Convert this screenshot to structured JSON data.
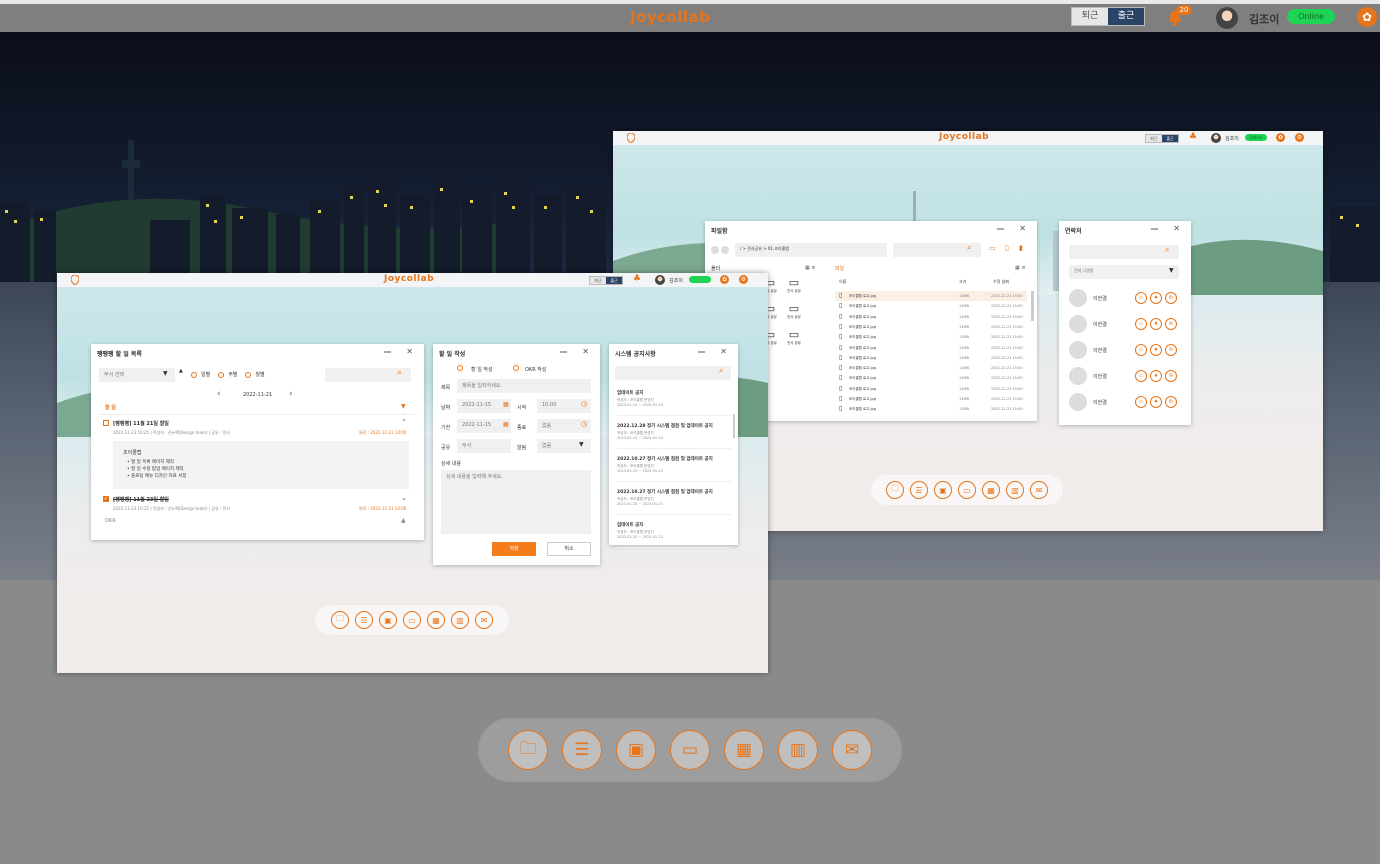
{
  "header": {
    "logo": "Joycollab",
    "clock_out": "퇴근",
    "clock_in": "출근",
    "notification_count": "20",
    "user_name": "김조이",
    "status": "Online"
  },
  "desktop2": {
    "logo": "Joycollab",
    "clock_out": "퇴근",
    "clock_in": "출근",
    "user_name": "김조이",
    "status": "Online",
    "files_window": {
      "title": "파일함",
      "path": "/ > 전사공유 > 01.조이콜랩",
      "folder_header": "폴더",
      "file_header": "파일",
      "columns": [
        "이름",
        "크기",
        "수정 날짜"
      ],
      "folder_label": "전사 공유",
      "files": [
        {
          "name": "조이콜랩 로고.jpg",
          "size": "11MB",
          "date": "2022-12-21 15:00"
        },
        {
          "name": "조이콜랩 로고.jpg",
          "size": "11MB",
          "date": "2022-12-21 15:00"
        },
        {
          "name": "조이콜랩 로고.jpg",
          "size": "11MB",
          "date": "2022-12-21 15:00"
        },
        {
          "name": "조이콜랩 로고.jpg",
          "size": "11MB",
          "date": "2022-12-21 15:00"
        },
        {
          "name": "조이콜랩 로고.jpg",
          "size": "11MB",
          "date": "2022-12-21 15:00"
        },
        {
          "name": "조이콜랩 로고.jpg",
          "size": "11MB",
          "date": "2022-12-21 15:00"
        },
        {
          "name": "조이콜랩 로고.jpg",
          "size": "11MB",
          "date": "2022-12-21 15:00"
        },
        {
          "name": "조이콜랩 로고.jpg",
          "size": "11MB",
          "date": "2022-12-21 15:00"
        },
        {
          "name": "조이콜랩 로고.jpg",
          "size": "11MB",
          "date": "2022-12-21 15:00"
        },
        {
          "name": "조이콜랩 로고.jpg",
          "size": "11MB",
          "date": "2022-12-21 15:00"
        },
        {
          "name": "조이콜랩 로고.jpg",
          "size": "11MB",
          "date": "2022-12-21 15:00"
        },
        {
          "name": "조이콜랩 로고.jpg",
          "size": "11MB",
          "date": "2022-12-21 15:00"
        }
      ]
    },
    "contacts_window": {
      "title": "연락처",
      "select": "전체 나열함",
      "contacts": [
        "이한결",
        "이한결",
        "이한결",
        "이한결",
        "이한결"
      ]
    }
  },
  "desktop1": {
    "logo": "Joycollab",
    "clock_out": "퇴근",
    "clock_in": "출근",
    "user_name": "김조이",
    "todo_window": {
      "title": "팽팽팽 할 일 목록",
      "dept_select": "부서 선택",
      "radio": [
        "일별",
        "주별",
        "월별"
      ],
      "date": "2022-11-21",
      "section_todo": "할 일",
      "item1_title": "[팽팽팽] 11월 21일 할일",
      "item1_meta": "2022-11-23 10:25  |  작성자 : 신뉴팩(Design team)  |  공유 : 전사",
      "item1_due": "완료 : 2022-12-21 14:00",
      "item1_body_title": "조이콜랩",
      "item1_body_lines": [
        "할 일 목록 페이지 제작",
        "할 일 수정 팝업 메이지 제작",
        "플로팅 메뉴 디자인 자료 서칭"
      ],
      "item2_title": "[팽팽팽] 11월 23일 할일",
      "item2_meta": "2022-11-23 10:25  |  작성자 : 신뉴팩(Design team)  |  공유 : 전사",
      "item2_due": "완료 : 2022-12-21 14:00",
      "section_okr": "OKR"
    },
    "write_window": {
      "title": "할 일 작성",
      "radio": [
        "할 일 작성",
        "OKR 작성"
      ],
      "subject_label": "제목",
      "subject_placeholder": "제목을 입력하세요.",
      "date_label": "날짜",
      "date_value": "2022-11-15",
      "start_label": "시작",
      "start_value": "10:00",
      "due_label": "기한",
      "due_value": "2022-11-15",
      "end_label": "종료",
      "end_value": "없음",
      "share_label": "공유",
      "share_value": "부서",
      "alarm_label": "알림",
      "alarm_value": "없음",
      "detail_label": "상세 내용",
      "detail_placeholder": "상세 내용을 입력해 주세요.",
      "save": "저장",
      "cancel": "취소"
    },
    "notice_window": {
      "title": "시스템 공지사항",
      "notices": [
        {
          "title": "업데이트 공지",
          "author": "작성자 : 조이콜랩 운영진",
          "period": "2023-01-10 ~ 2023-01-24"
        },
        {
          "title": "2022.12.28 정기 시스템 점검 및 업데이트 공지",
          "author": "작성자 : 조이콜랩 운영진",
          "period": "2023-01-10 ~ 2023-01-23"
        },
        {
          "title": "2022.10.27 정기 시스템 점검 및 업데이트 공지",
          "author": "작성자 : 조이콜랩 운영진",
          "period": "2023-01-10 ~ 2023-01-23"
        },
        {
          "title": "2022.10.27 정기 시스템 점검 및 업데이트 공지",
          "author": "작성자 : 조이콜랩 운영진",
          "period": "2023-01-10 ~ 2023-01-23"
        },
        {
          "title": "업데이트 공지",
          "author": "작성자 : 조이콜랩 운영진",
          "period": "2023-01-10 ~ 2023-01-23"
        }
      ]
    }
  },
  "dock_icons": [
    "folder-icon",
    "list-icon",
    "contacts-icon",
    "laptop-icon",
    "calendar-icon",
    "library-icon",
    "chat-icon"
  ]
}
